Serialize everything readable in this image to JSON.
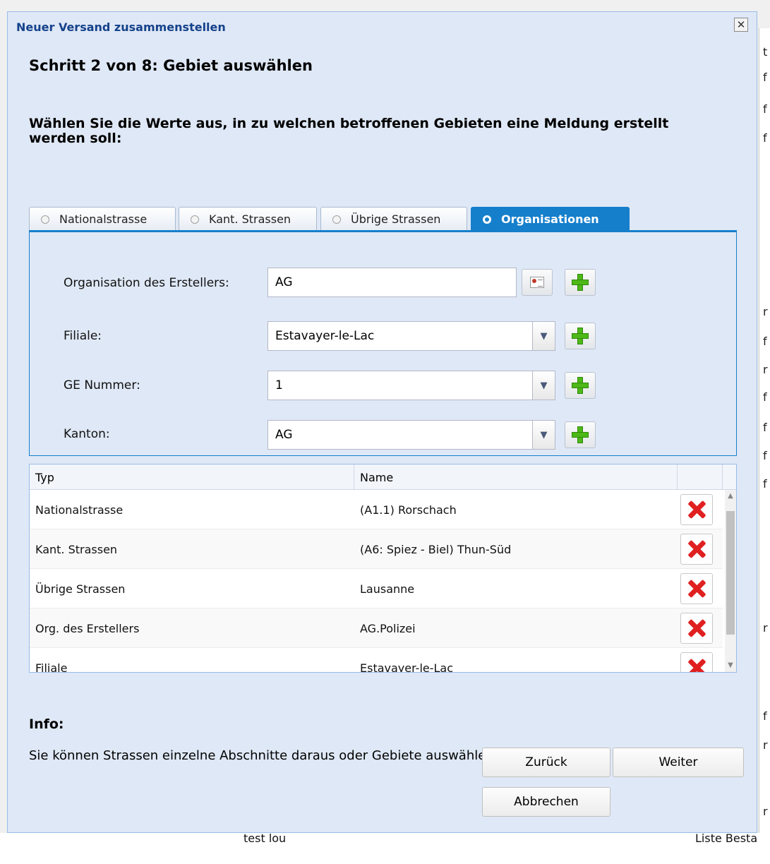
{
  "dialog": {
    "title": "Neuer Versand zusammenstellen",
    "step_title": "Schritt 2 von 8: Gebiet auswählen",
    "instruction": "Wählen Sie die Werte aus, in zu welchen betroffenen Gebieten eine Meldung erstellt werden soll:"
  },
  "tabs": [
    {
      "label": "Nationalstrasse",
      "selected": false
    },
    {
      "label": "Kant. Strassen",
      "selected": false
    },
    {
      "label": "Übrige Strassen",
      "selected": false
    },
    {
      "label": "Organisationen",
      "selected": true
    }
  ],
  "form": {
    "org_label": "Organisation des Erstellers:",
    "org_value": "AG",
    "filiale_label": "Filiale:",
    "filiale_value": "Estavayer-le-Lac",
    "ge_label": "GE Nummer:",
    "ge_value": "1",
    "kanton_label": "Kanton:",
    "kanton_value": "AG"
  },
  "grid": {
    "columns": [
      "Typ",
      "Name"
    ],
    "rows": [
      {
        "typ": "Nationalstrasse",
        "name": "(A1.1) Rorschach"
      },
      {
        "typ": "Kant. Strassen",
        "name": "(A6: Spiez - Biel) Thun-Süd"
      },
      {
        "typ": "Übrige Strassen",
        "name": "Lausanne"
      },
      {
        "typ": "Org. des Erstellers",
        "name": "AG.Polizei"
      },
      {
        "typ": "Filiale",
        "name": "Estavayer-le-Lac"
      }
    ]
  },
  "info": {
    "title": "Info:",
    "text": "Sie können Strassen einzelne Abschnitte daraus oder Gebiete auswählen."
  },
  "buttons": {
    "back": "Zurück",
    "next": "Weiter",
    "cancel": "Abbrechen"
  },
  "background": {
    "bottom_left": "test lou",
    "bottom_right": "Liste Besta"
  },
  "colors": {
    "accent": "#157fcc",
    "dialog_bg": "#dfe8f6",
    "title_blue": "#15428b",
    "delete_red": "#e02020",
    "add_green": "#4db818"
  }
}
